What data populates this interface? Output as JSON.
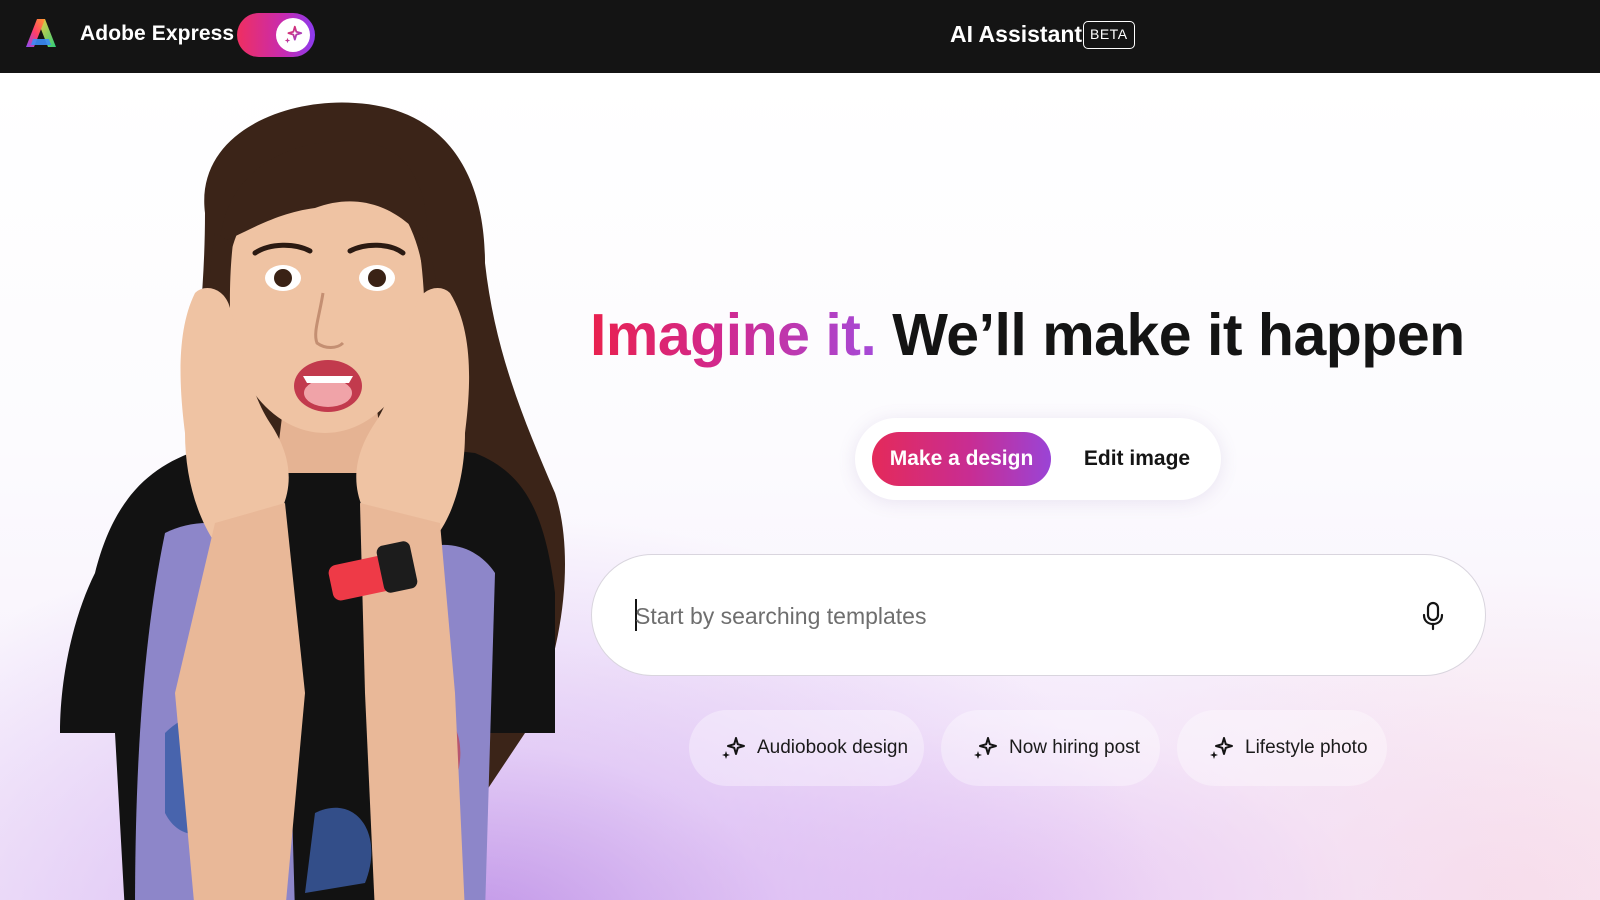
{
  "header": {
    "app_name": "Adobe Express",
    "assistant_title": "AI Assistant",
    "beta_badge": "BETA",
    "ai_toggle_on": true
  },
  "hero": {
    "headline_highlight": "Imagine it.",
    "headline_rest": "We’ll make it happen",
    "modes": [
      {
        "label": "Make a design",
        "selected": true
      },
      {
        "label": "Edit image",
        "selected": false
      }
    ],
    "search": {
      "placeholder": "Start by searching templates",
      "value": ""
    },
    "suggestions": [
      {
        "label": "Audiobook design",
        "icon": "sparkle-icon"
      },
      {
        "label": "Now hiring post",
        "icon": "sparkle-icon"
      },
      {
        "label": "Lifestyle photo",
        "icon": "sparkle-icon"
      }
    ]
  },
  "colors": {
    "topbar_bg": "#141414",
    "accent_start": "#e42a5a",
    "accent_mid": "#c82d93",
    "accent_end": "#9a44d6",
    "headline_dark": "#141414"
  }
}
